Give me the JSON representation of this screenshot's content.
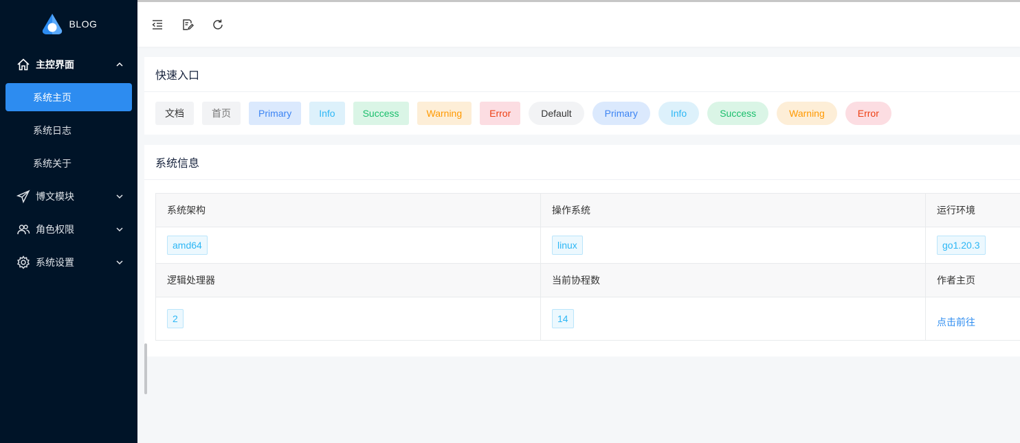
{
  "brand": {
    "name": "BLOG"
  },
  "sidebar": {
    "groups": [
      {
        "label": "主控界面",
        "icon": "home-icon",
        "open": true,
        "children": [
          {
            "label": "系统主页",
            "active": true
          },
          {
            "label": "系统日志"
          },
          {
            "label": "系统关于"
          }
        ]
      },
      {
        "label": "博文模块",
        "icon": "send-icon"
      },
      {
        "label": "角色权限",
        "icon": "users-icon"
      },
      {
        "label": "系统设置",
        "icon": "gear-icon"
      }
    ]
  },
  "toolbar": {
    "icons": [
      "menu-collapse-icon",
      "edit-note-icon",
      "refresh-icon"
    ]
  },
  "quick": {
    "title": "快速入口",
    "buttons": [
      "文档",
      "首页",
      "Primary",
      "Info",
      "Success",
      "Warning",
      "Error",
      "Default",
      "Primary",
      "Info",
      "Success",
      "Warning",
      "Error"
    ]
  },
  "sysinfo": {
    "title": "系统信息",
    "headers1": [
      "系统架构",
      "操作系统",
      "运行环境"
    ],
    "values1": [
      "amd64",
      "linux",
      "go1.20.3"
    ],
    "headers2": [
      "逻辑处理器",
      "当前协程数",
      "作者主页"
    ],
    "values2": [
      "2",
      "14"
    ],
    "link": "点击前往"
  },
  "colors": {
    "sidebar_bg": "#001428",
    "accent": "#2d8cf0"
  }
}
